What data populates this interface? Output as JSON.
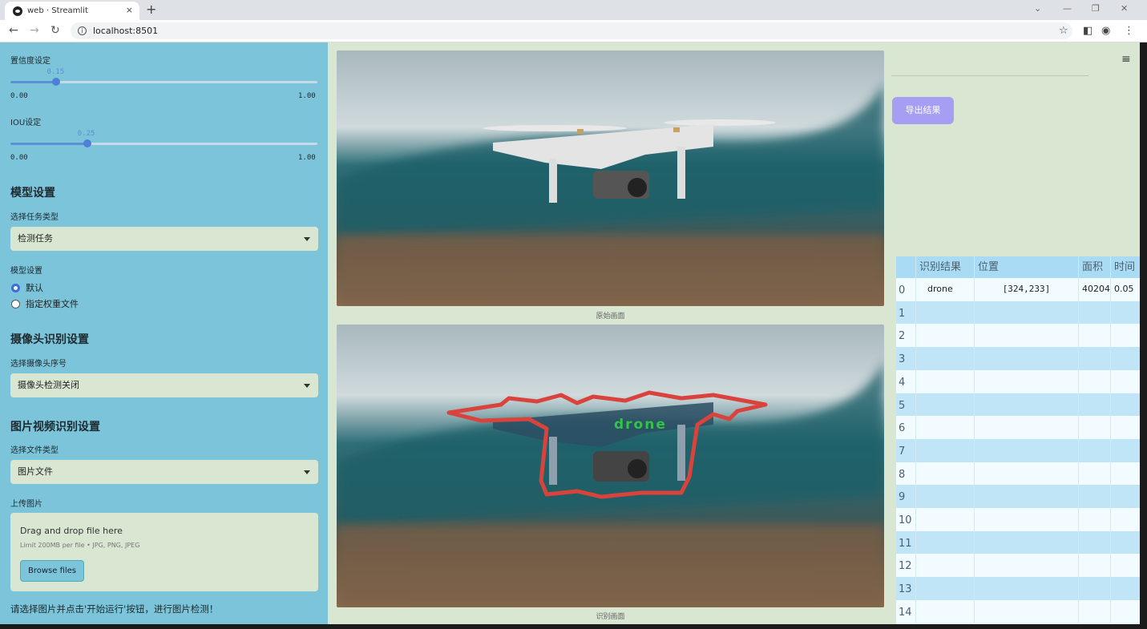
{
  "browser": {
    "tab_title": "web · Streamlit",
    "tab_close": "×",
    "new_tab": "+",
    "url": "localhost:8501"
  },
  "sidebar": {
    "confidence": {
      "label": "置信度设定",
      "value": "0.15",
      "fraction": 0.15,
      "min": "0.00",
      "max": "1.00"
    },
    "iou": {
      "label": "IOU设定",
      "value": "0.25",
      "fraction": 0.25,
      "min": "0.00",
      "max": "1.00"
    },
    "model_header": "模型设置",
    "task_label": "选择任务类型",
    "task_value": "检测任务",
    "model_label": "模型设置",
    "model_options": [
      "默认",
      "指定权重文件"
    ],
    "camera_header": "摄像头识别设置",
    "camera_label": "选择摄像头序号",
    "camera_value": "摄像头检测关闭",
    "media_header": "图片视频识别设置",
    "filetype_label": "选择文件类型",
    "filetype_value": "图片文件",
    "upload_label": "上传图片",
    "upload_drag": "Drag and drop file here",
    "upload_limit": "Limit 200MB per file • JPG, PNG, JPEG",
    "upload_button": "Browse files",
    "hint": "请选择图片并点击'开始运行'按钮，进行图片检测！"
  },
  "main": {
    "original_caption": "原始画面",
    "result_caption": "识别画面",
    "detection_label": "drone"
  },
  "right": {
    "export_button": "导出结果",
    "table": {
      "headers": [
        "识别结果",
        "位置",
        "面积",
        "时间"
      ],
      "rows": [
        {
          "index": "0",
          "result": "drone",
          "position": "[324,233]",
          "area": "40204",
          "time": "0.05"
        },
        {
          "index": "1"
        },
        {
          "index": "2"
        },
        {
          "index": "3"
        },
        {
          "index": "4"
        },
        {
          "index": "5"
        },
        {
          "index": "6"
        },
        {
          "index": "7"
        },
        {
          "index": "8"
        },
        {
          "index": "9"
        },
        {
          "index": "10"
        },
        {
          "index": "11"
        },
        {
          "index": "12"
        },
        {
          "index": "13"
        },
        {
          "index": "14"
        }
      ]
    }
  },
  "colors": {
    "sidebar_bg": "#7cc4d9",
    "app_bg": "#d9e6d2",
    "slider_accent": "#5b8fd6",
    "export_btn": "#a59ef2",
    "table_header_bg": "#a9dcf4",
    "table_row_alt": "#bfe5f7",
    "mask_outline": "#d9433b",
    "detection_text": "#33c24a"
  }
}
